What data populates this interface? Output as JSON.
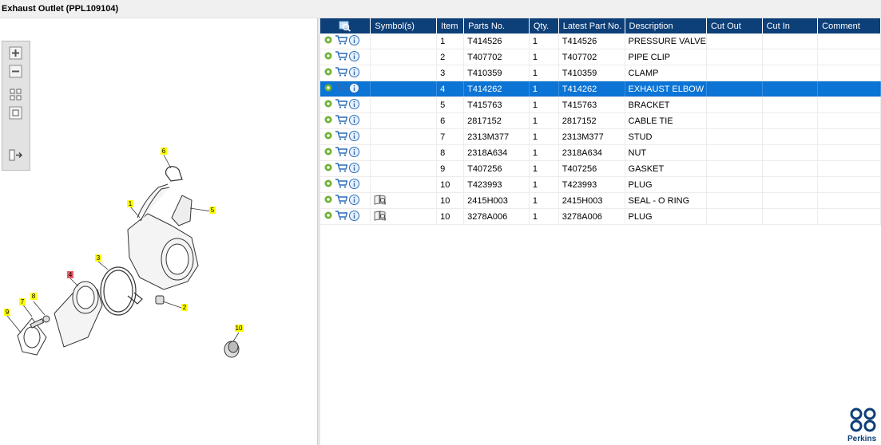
{
  "window": {
    "title": "Exhaust Outlet (PPL109104)"
  },
  "toolbar": {
    "buttons": [
      "zoom-in-icon",
      "zoom-out-icon",
      "fit-all-icon",
      "fit-window-icon",
      "sidebar-toggle-icon"
    ]
  },
  "diagram": {
    "callouts": [
      "6",
      "1",
      "5",
      "3",
      "4",
      "8",
      "7",
      "9",
      "2",
      "10"
    ],
    "highlighted_callout": "4"
  },
  "table": {
    "columns": [
      "",
      "Symbol(s)",
      "Item",
      "Parts No.",
      "Qty.",
      "Latest Part No.",
      "Description",
      "Cut Out",
      "Cut In",
      "Comment"
    ],
    "rows": [
      {
        "item": "1",
        "part": "T414526",
        "qty": "1",
        "latest": "T414526",
        "desc": "PRESSURE VALVE",
        "cut_out": "",
        "cut_in": "",
        "comment": ""
      },
      {
        "item": "2",
        "part": "T407702",
        "qty": "1",
        "latest": "T407702",
        "desc": "PIPE CLIP",
        "cut_out": "",
        "cut_in": "",
        "comment": ""
      },
      {
        "item": "3",
        "part": "T410359",
        "qty": "1",
        "latest": "T410359",
        "desc": "CLAMP",
        "cut_out": "",
        "cut_in": "",
        "comment": ""
      },
      {
        "item": "4",
        "part": "T414262",
        "qty": "1",
        "latest": "T414262",
        "desc": "EXHAUST ELBOW",
        "cut_out": "",
        "cut_in": "",
        "comment": ""
      },
      {
        "item": "5",
        "part": "T415763",
        "qty": "1",
        "latest": "T415763",
        "desc": "BRACKET",
        "cut_out": "",
        "cut_in": "",
        "comment": ""
      },
      {
        "item": "6",
        "part": "2817152",
        "qty": "1",
        "latest": "2817152",
        "desc": "CABLE TIE",
        "cut_out": "",
        "cut_in": "",
        "comment": ""
      },
      {
        "item": "7",
        "part": "2313M377",
        "qty": "1",
        "latest": "2313M377",
        "desc": "STUD",
        "cut_out": "",
        "cut_in": "",
        "comment": ""
      },
      {
        "item": "8",
        "part": "2318A634",
        "qty": "1",
        "latest": "2318A634",
        "desc": "NUT",
        "cut_out": "",
        "cut_in": "",
        "comment": ""
      },
      {
        "item": "9",
        "part": "T407256",
        "qty": "1",
        "latest": "T407256",
        "desc": "GASKET",
        "cut_out": "",
        "cut_in": "",
        "comment": ""
      },
      {
        "item": "10",
        "part": "T423993",
        "qty": "1",
        "latest": "T423993",
        "desc": "PLUG",
        "cut_out": "",
        "cut_in": "",
        "comment": ""
      },
      {
        "item": "10",
        "part": "2415H003",
        "qty": "1",
        "latest": "2415H003",
        "desc": "SEAL - O RING",
        "cut_out": "",
        "cut_in": "",
        "comment": ""
      },
      {
        "item": "10",
        "part": "3278A006",
        "qty": "1",
        "latest": "3278A006",
        "desc": "PLUG",
        "cut_out": "",
        "cut_in": "",
        "comment": ""
      }
    ],
    "selected_row": 3,
    "rows_with_symbol": [
      10,
      11
    ]
  },
  "brand": {
    "name": "Perkins",
    "color": "#0d3f78"
  },
  "colors": {
    "header_bg": "#0d3f78",
    "selected_row": "#0b74d5",
    "callout_yellow": "#ffff00",
    "callout_red": "#e85a6a"
  }
}
